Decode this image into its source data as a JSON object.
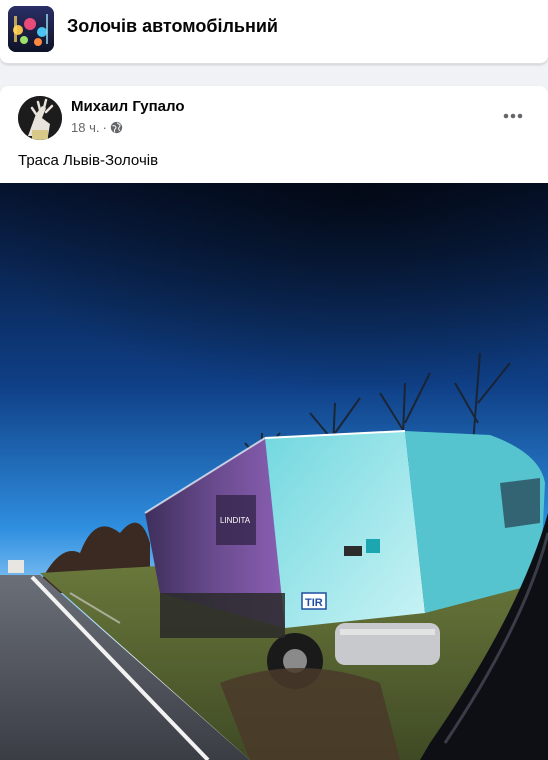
{
  "group": {
    "title": "Золочів автомобільний",
    "avatar_icon": "group-avatar-city-lights"
  },
  "post": {
    "author": "Михаил Гупало",
    "time": "18 ч.",
    "separator": "·",
    "privacy_icon": "globe-icon",
    "more_icon": "more-dots-icon",
    "text": "Траса Львів-Золочів",
    "photo": {
      "truck_badge": "TIR",
      "trailer_brand": "LINDITA"
    }
  },
  "colors": {
    "page_bg": "#f0f2f5",
    "card_bg": "#ffffff",
    "text_primary": "#050505",
    "text_secondary": "#65676b",
    "sky_top": "#0b1a3a",
    "sky_mid": "#1e6fc4",
    "truck_cyan": "#5fd6dc"
  }
}
